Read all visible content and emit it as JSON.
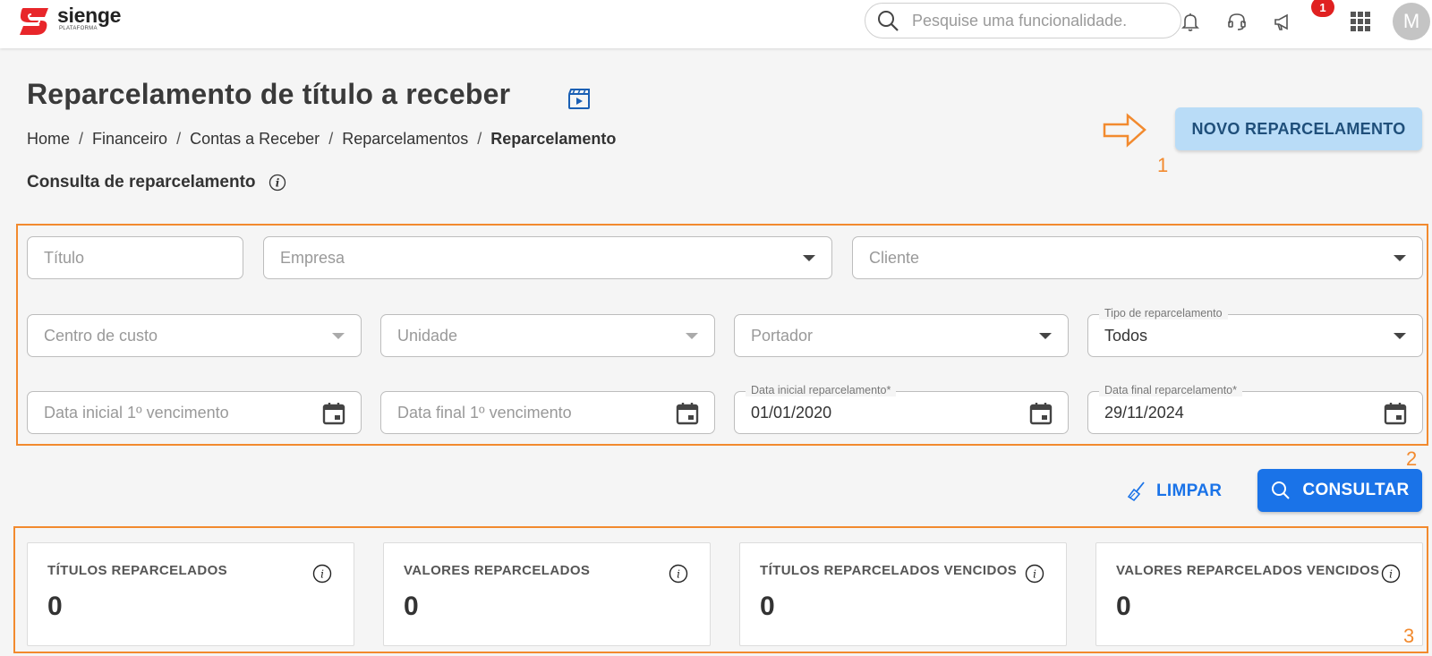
{
  "app": {
    "logo_name": "sienge",
    "logo_sub": "PLATAFORMA",
    "search_placeholder": "Pesquise uma funcionalidade.",
    "notification_badge": "1",
    "avatar_initial": "M",
    "brand_color": "#e8262a"
  },
  "page": {
    "title": "Reparcelamento de título a receber",
    "breadcrumb": [
      "Home",
      "Financeiro",
      "Contas a Receber",
      "Reparcelamentos",
      "Reparcelamento"
    ],
    "subtitle": "Consulta de reparcelamento"
  },
  "actions": {
    "new_label": "NOVO REPARCELAMENTO",
    "clear_label": "LIMPAR",
    "search_label": "CONSULTAR"
  },
  "annotations": [
    "1",
    "2",
    "3"
  ],
  "filters": {
    "titulo": "Título",
    "empresa": "Empresa",
    "cliente": "Cliente",
    "centro_custo": "Centro de custo",
    "unidade": "Unidade",
    "portador": "Portador",
    "tipo_label": "Tipo de reparcelamento",
    "tipo_value": "Todos",
    "data_ini_venc": "Data inicial 1º vencimento",
    "data_fim_venc": "Data final 1º vencimento",
    "data_ini_rep_label": "Data inicial reparcelamento*",
    "data_ini_rep_value": "01/01/2020",
    "data_fim_rep_label": "Data final reparcelamento*",
    "data_fim_rep_value": "29/11/2024"
  },
  "cards": [
    {
      "label": "TÍTULOS REPARCELADOS",
      "value": "0"
    },
    {
      "label": "VALORES REPARCELADOS",
      "value": "0"
    },
    {
      "label": "TÍTULOS REPARCELADOS VENCIDOS",
      "value": "0"
    },
    {
      "label": "VALORES REPARCELADOS VENCIDOS",
      "value": "0"
    }
  ]
}
